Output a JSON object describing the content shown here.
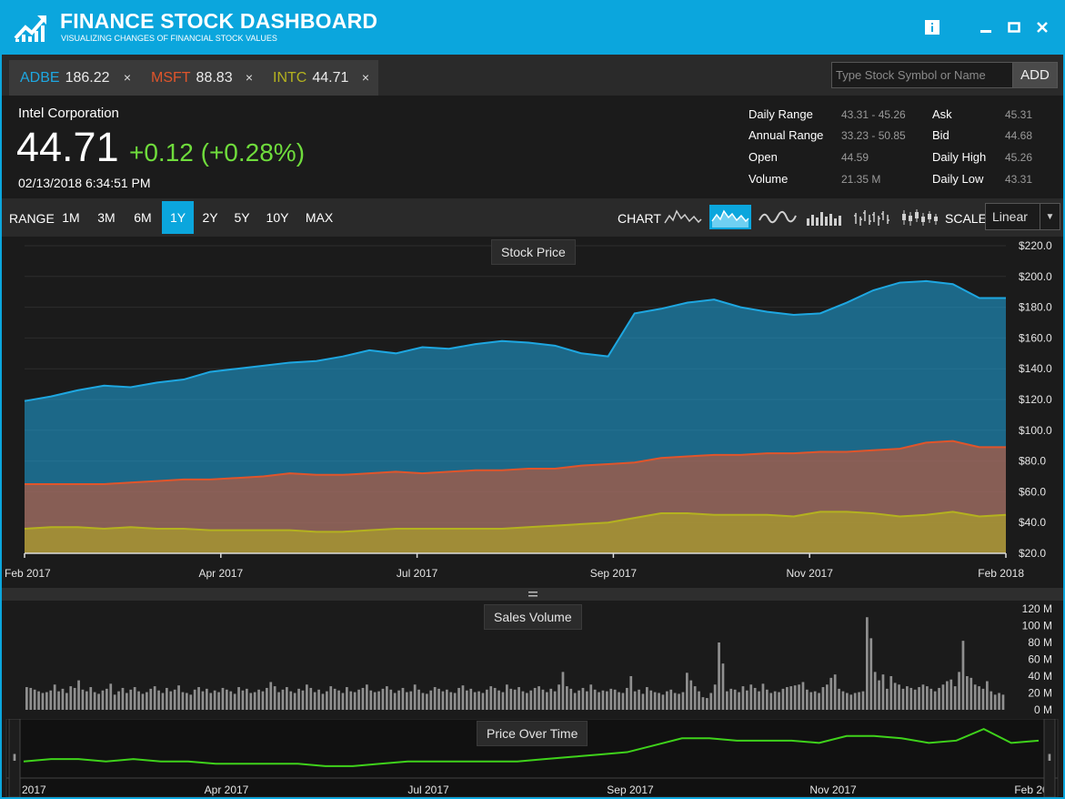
{
  "app": {
    "title": "FINANCE STOCK DASHBOARD",
    "subtitle": "VISUALIZING CHANGES OF FINANCIAL STOCK VALUES",
    "accent_color": "#0ba6dd"
  },
  "tabs": [
    {
      "symbol": "ADBE",
      "price": "186.22",
      "close": "×",
      "color": "#1ea7e1"
    },
    {
      "symbol": "MSFT",
      "price": "88.83",
      "close": "×",
      "color": "#e0552b"
    },
    {
      "symbol": "INTC",
      "price": "44.71",
      "close": "×",
      "color": "#b4b21f"
    }
  ],
  "search": {
    "placeholder": "Type Stock Symbol or Name",
    "button_label": "ADD"
  },
  "quote": {
    "company": "Intel Corporation",
    "price": "44.71",
    "change": "+0.12 (+0.28%)",
    "timestamp": "02/13/2018 6:34:51 PM",
    "change_color": "#6fdc3c",
    "stats_left": [
      {
        "label": "Daily Range",
        "value": "43.31 - 45.26"
      },
      {
        "label": "Annual Range",
        "value": "33.23 - 50.85"
      },
      {
        "label": "Open",
        "value": "44.59"
      },
      {
        "label": "Volume",
        "value": "21.35 M"
      }
    ],
    "stats_right": [
      {
        "label": "Ask",
        "value": "45.31"
      },
      {
        "label": "Bid",
        "value": "44.68"
      },
      {
        "label": "Daily High",
        "value": "45.26"
      },
      {
        "label": "Daily Low",
        "value": "43.31"
      }
    ]
  },
  "toolbar": {
    "range_label": "RANGE",
    "ranges": [
      "1M",
      "3M",
      "6M",
      "1Y",
      "2Y",
      "5Y",
      "10Y",
      "MAX"
    ],
    "active_range": "1Y",
    "chart_label": "CHART",
    "chart_types": [
      "line-chart-icon",
      "area-chart-icon",
      "spline-chart-icon",
      "column-chart-icon",
      "ohlc-chart-icon",
      "candlestick-chart-icon"
    ],
    "active_chart_type": "area-chart-icon",
    "scale_label": "SCALE",
    "scale_value": "Linear"
  },
  "chart_data": [
    {
      "type": "area",
      "title": "Stock Price",
      "y_ticks": [
        "$20.0",
        "$40.0",
        "$60.0",
        "$80.0",
        "$100.0",
        "$120.0",
        "$140.0",
        "$160.0",
        "$180.0",
        "$200.0",
        "$220.0"
      ],
      "ylim": [
        20,
        220
      ],
      "x_ticks": [
        "Feb 2017",
        "Apr 2017",
        "Jul 2017",
        "Sep 2017",
        "Nov 2017",
        "Feb 2018"
      ],
      "x_tick_fractions": [
        0,
        0.2,
        0.4,
        0.6,
        0.8,
        1.0
      ],
      "grid": true,
      "series": [
        {
          "color": "#1ea7e1",
          "values": [
            119,
            122,
            126,
            129,
            128,
            131,
            133,
            138,
            140,
            142,
            144,
            145,
            148,
            152,
            150,
            154,
            153,
            156,
            158,
            157,
            155,
            150,
            148,
            176,
            179,
            183,
            185,
            180,
            177,
            175,
            176,
            183,
            191,
            196,
            197,
            195,
            186,
            186
          ]
        },
        {
          "color": "#e0552b",
          "values": [
            65,
            65,
            65,
            65,
            66,
            67,
            68,
            68,
            69,
            70,
            72,
            71,
            71,
            72,
            73,
            72,
            73,
            74,
            74,
            75,
            75,
            77,
            78,
            79,
            82,
            83,
            84,
            84,
            85,
            85,
            86,
            86,
            87,
            88,
            92,
            93,
            89,
            89
          ]
        },
        {
          "color": "#b4b21f",
          "values": [
            36,
            37,
            37,
            36,
            37,
            36,
            36,
            35,
            35,
            35,
            35,
            34,
            34,
            35,
            36,
            36,
            36,
            36,
            36,
            37,
            38,
            39,
            40,
            43,
            46,
            46,
            45,
            45,
            45,
            44,
            47,
            47,
            46,
            44,
            45,
            47,
            44,
            45
          ]
        }
      ]
    },
    {
      "type": "bar",
      "title": "Sales Volume",
      "y_ticks": [
        "0 M",
        "20 M",
        "40 M",
        "60 M",
        "80 M",
        "100 M",
        "120 M"
      ],
      "ylim": [
        0,
        120
      ],
      "bar_color": "#8f8f8f",
      "values": [
        27,
        26,
        24,
        22,
        20,
        21,
        23,
        30,
        22,
        25,
        20,
        28,
        26,
        35,
        24,
        22,
        27,
        21,
        19,
        23,
        25,
        31,
        18,
        22,
        26,
        20,
        24,
        27,
        22,
        19,
        21,
        25,
        28,
        23,
        20,
        26,
        22,
        24,
        29,
        21,
        20,
        18,
        24,
        27,
        22,
        25,
        20,
        23,
        21,
        26,
        24,
        22,
        19,
        27,
        23,
        25,
        20,
        21,
        24,
        22,
        26,
        33,
        28,
        21,
        24,
        27,
        22,
        20,
        25,
        23,
        30,
        26,
        21,
        24,
        19,
        22,
        28,
        25,
        23,
        20,
        27,
        22,
        21,
        24,
        26,
        30,
        23,
        21,
        22,
        25,
        28,
        24,
        20,
        23,
        26,
        21,
        22,
        30,
        24,
        20,
        19,
        23,
        27,
        25,
        22,
        24,
        21,
        20,
        26,
        29,
        23,
        25,
        21,
        22,
        20,
        24,
        28,
        26,
        23,
        21,
        30,
        25,
        24,
        27,
        22,
        20,
        23,
        26,
        28,
        24,
        21,
        25,
        22,
        30,
        45,
        28,
        25,
        20,
        23,
        26,
        22,
        30,
        24,
        21,
        23,
        22,
        25,
        24,
        21,
        20,
        26,
        40,
        22,
        24,
        19,
        27,
        23,
        21,
        20,
        18,
        22,
        24,
        20,
        19,
        21,
        44,
        35,
        28,
        22,
        15,
        14,
        20,
        30,
        80,
        55,
        22,
        25,
        24,
        21,
        28,
        23,
        30,
        26,
        22,
        31,
        24,
        20,
        22,
        21,
        25,
        27,
        28,
        29,
        30,
        33,
        24,
        21,
        22,
        20,
        27,
        30,
        38,
        42,
        25,
        22,
        20,
        18,
        20,
        21,
        22,
        110,
        85,
        45,
        35,
        42,
        25,
        40,
        32,
        30,
        25,
        28,
        26,
        24,
        27,
        30,
        28,
        25,
        22,
        26,
        30,
        34,
        36,
        28,
        45,
        82,
        40,
        38,
        30,
        28,
        25,
        34,
        22,
        18,
        20,
        18
      ]
    },
    {
      "type": "line",
      "title": "Price Over Time",
      "x_ticks": [
        "2017",
        "Apr 2017",
        "Jul 2017",
        "Sep 2017",
        "Nov 2017",
        "Feb 20"
      ],
      "line_color": "#3fd21b",
      "values": [
        36,
        37,
        37,
        36,
        37,
        36,
        36,
        35,
        35,
        35,
        35,
        34,
        34,
        35,
        36,
        36,
        36,
        36,
        36,
        37,
        38,
        39,
        40,
        43,
        46,
        46,
        45,
        45,
        45,
        44,
        47,
        47,
        46,
        44,
        45,
        50,
        44,
        45
      ]
    }
  ]
}
